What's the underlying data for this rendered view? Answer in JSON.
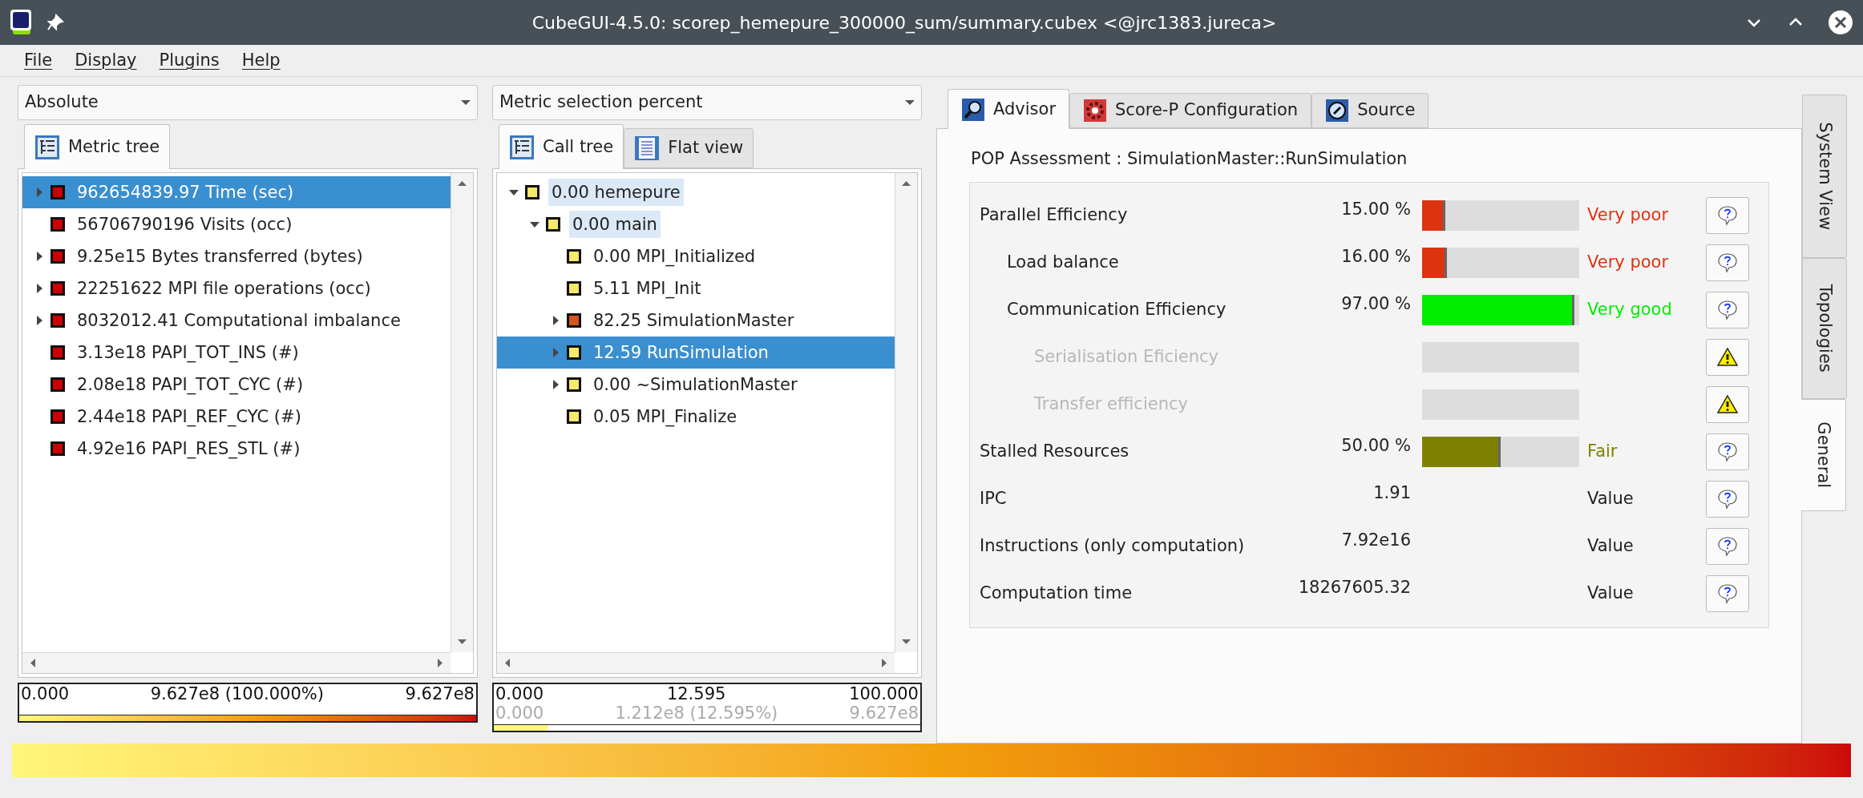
{
  "window": {
    "title": "CubeGUI-4.5.0: scorep_hemepure_300000_sum/summary.cubex <@jrc1383.jureca>"
  },
  "menu": [
    "File",
    "Display",
    "Plugins",
    "Help"
  ],
  "metric_panel": {
    "dropdown": "Absolute",
    "tabs": [
      {
        "label": "Metric tree",
        "selected": true
      }
    ],
    "tree": [
      {
        "label": "962654839.97 Time (sec)",
        "color": "#cc0000",
        "expanded": false,
        "selected": true
      },
      {
        "label": "56706790196 Visits (occ)",
        "color": "#cc0000",
        "selected": false
      },
      {
        "label": "9.25e15 Bytes transferred (bytes)",
        "color": "#cc0000",
        "expanded": false,
        "selected": false
      },
      {
        "label": "22251622 MPI file operations (occ)",
        "color": "#cc0000",
        "expanded": false,
        "selected": false
      },
      {
        "label": "8032012.41 Computational imbalance",
        "color": "#cc0000",
        "expanded": false,
        "selected": false
      },
      {
        "label": "3.13e18 PAPI_TOT_INS (#)",
        "color": "#cc0000",
        "selected": false
      },
      {
        "label": "2.08e18 PAPI_TOT_CYC (#)",
        "color": "#cc0000",
        "selected": false
      },
      {
        "label": "2.44e18 PAPI_REF_CYC (#)",
        "color": "#cc0000",
        "selected": false
      },
      {
        "label": "4.92e16 PAPI_RES_STL (#)",
        "color": "#cc0000",
        "selected": false
      }
    ],
    "summary": {
      "lines": [
        [
          "0.000",
          "9.627e8 (100.000%)",
          "9.627e8"
        ]
      ],
      "level": 1
    }
  },
  "call_panel": {
    "dropdown": "Metric selection percent",
    "tabs": [
      {
        "label": "Call tree",
        "selected": true
      },
      {
        "label": "Flat view",
        "selected": false
      }
    ],
    "tree": [
      {
        "label": "0.00 hemepure",
        "color": "#f7e96a",
        "expanded": true,
        "selected": false,
        "highlighted": true,
        "children": [
          {
            "label": "0.00 main",
            "color": "#f7e96a",
            "expanded": true,
            "selected": false,
            "highlighted": true,
            "children": [
              {
                "label": "0.00 MPI_Initialized",
                "color": "#f7e96a",
                "selected": false
              },
              {
                "label": "5.11 MPI_Init",
                "color": "#f7e96a",
                "selected": false
              },
              {
                "label": "82.25 SimulationMaster",
                "color": "#d5561c",
                "expanded": false,
                "selected": false
              },
              {
                "label": "12.59 RunSimulation",
                "color": "#f7e96a",
                "expanded": false,
                "selected": true
              },
              {
                "label": "0.00 ~SimulationMaster",
                "color": "#f7e96a",
                "expanded": false,
                "selected": false
              },
              {
                "label": "0.05 MPI_Finalize",
                "color": "#f7e96a",
                "selected": false
              }
            ]
          }
        ]
      }
    ],
    "summary": {
      "lines": [
        [
          "0.000",
          "12.595",
          "100.000"
        ],
        [
          "0.000",
          "1.212e8 (12.595%)",
          "9.627e8"
        ]
      ],
      "level": 0.126
    }
  },
  "advisor": {
    "tabs": [
      {
        "label": "Advisor",
        "selected": true
      },
      {
        "label": "Score-P Configuration",
        "selected": false
      },
      {
        "label": "Source",
        "selected": false
      }
    ],
    "title": "POP Assessment : SimulationMaster::RunSimulation",
    "rows": [
      {
        "kind": "bar",
        "label": "Parallel Efficiency",
        "value": "15.00 %",
        "level": 0.15,
        "color": "#dd3311",
        "rating": "Very poor",
        "warning": false,
        "children": [
          {
            "kind": "bar",
            "label": "Load balance",
            "value": "16.00 %",
            "level": 0.16,
            "color": "#dd3311",
            "rating": "Very poor",
            "warning": false
          },
          {
            "kind": "bar",
            "label": "Communication Efficiency",
            "value": "97.00 %",
            "level": 0.97,
            "color": "#00ee00",
            "rating": "Very good",
            "warning": false,
            "children": [
              {
                "kind": "bar",
                "label": "Serialisation Eficiency",
                "disabled": true,
                "warning": true
              },
              {
                "kind": "bar",
                "label": "Transfer efficiency",
                "disabled": true,
                "warning": true
              }
            ]
          }
        ]
      },
      {
        "kind": "bar",
        "label": "Stalled Resources",
        "value": "50.00 %",
        "level": 0.5,
        "color": "#808000",
        "rating": "Fair",
        "warning": false
      },
      {
        "kind": "value",
        "label": "IPC",
        "value": "1.91",
        "rating": "Value",
        "warning": false
      },
      {
        "kind": "value",
        "label": "Instructions (only computation)",
        "value": "7.92e16",
        "rating": "Value",
        "warning": false
      },
      {
        "kind": "value",
        "label": "Computation time",
        "value": "18267605.32",
        "rating": "Value",
        "warning": false
      }
    ]
  },
  "side_tabs": [
    {
      "label": "System View",
      "selected": false
    },
    {
      "label": "Topologies",
      "selected": false
    },
    {
      "label": "General",
      "selected": true
    }
  ]
}
